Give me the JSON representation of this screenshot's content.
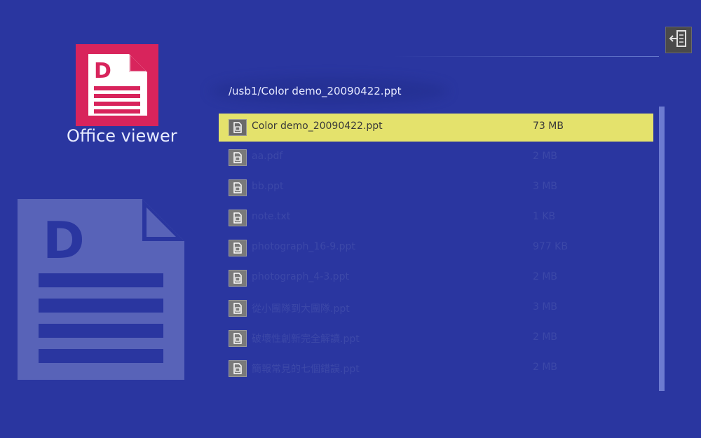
{
  "app": {
    "title": "Office viewer",
    "icon": "document-icon",
    "accent_color": "#d8245c",
    "background_color": "#2a36a0"
  },
  "header": {
    "path": "/usb1/Color demo_20090422.ppt",
    "exit_icon": "exit-icon"
  },
  "files": [
    {
      "name": "Color demo_20090422.ppt",
      "size": "73 MB",
      "selected": true
    },
    {
      "name": "aa.pdf",
      "size": "2 MB",
      "selected": false
    },
    {
      "name": "bb.ppt",
      "size": "3 MB",
      "selected": false
    },
    {
      "name": "note.txt",
      "size": "1 KB",
      "selected": false
    },
    {
      "name": "photograph_16-9.ppt",
      "size": "977 KB",
      "selected": false
    },
    {
      "name": "photograph_4-3.ppt",
      "size": "2 MB",
      "selected": false
    },
    {
      "name": "從小團隊到大團隊.ppt",
      "size": "3 MB",
      "selected": false
    },
    {
      "name": "破壞性創新完全解讀.ppt",
      "size": "2 MB",
      "selected": false
    },
    {
      "name": "簡報常見的七個錯誤.ppt",
      "size": "2 MB",
      "selected": false
    }
  ],
  "colors": {
    "selected_row": "#e4e26c",
    "scrollbar": "#6d7bd0"
  }
}
